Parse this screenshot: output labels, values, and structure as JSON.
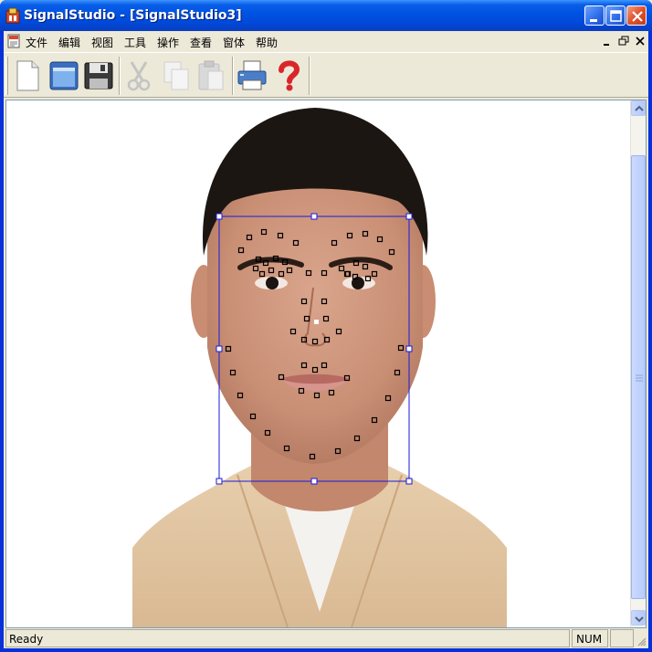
{
  "window": {
    "title": "SignalStudio - [SignalStudio3]"
  },
  "menu": {
    "items": [
      "文件",
      "编辑",
      "视图",
      "工具",
      "操作",
      "查看",
      "窗体",
      "帮助"
    ]
  },
  "toolbar": {
    "buttons": [
      {
        "icon": "new-document-icon",
        "enabled": true
      },
      {
        "icon": "open-folder-icon",
        "enabled": true
      },
      {
        "icon": "save-disk-icon",
        "enabled": true
      },
      {
        "icon": "cut-scissors-icon",
        "enabled": false
      },
      {
        "icon": "copy-icon",
        "enabled": false
      },
      {
        "icon": "paste-icon",
        "enabled": false
      },
      {
        "icon": "print-icon",
        "enabled": true
      },
      {
        "icon": "help-icon",
        "enabled": true
      }
    ]
  },
  "image": {
    "subject": "frontal face photograph",
    "landmark_color": "#000000",
    "bbox_color": "#1a1adc",
    "center_marker_color": "#ffffff"
  },
  "status": {
    "text": "Ready",
    "indicator": "NUM"
  }
}
